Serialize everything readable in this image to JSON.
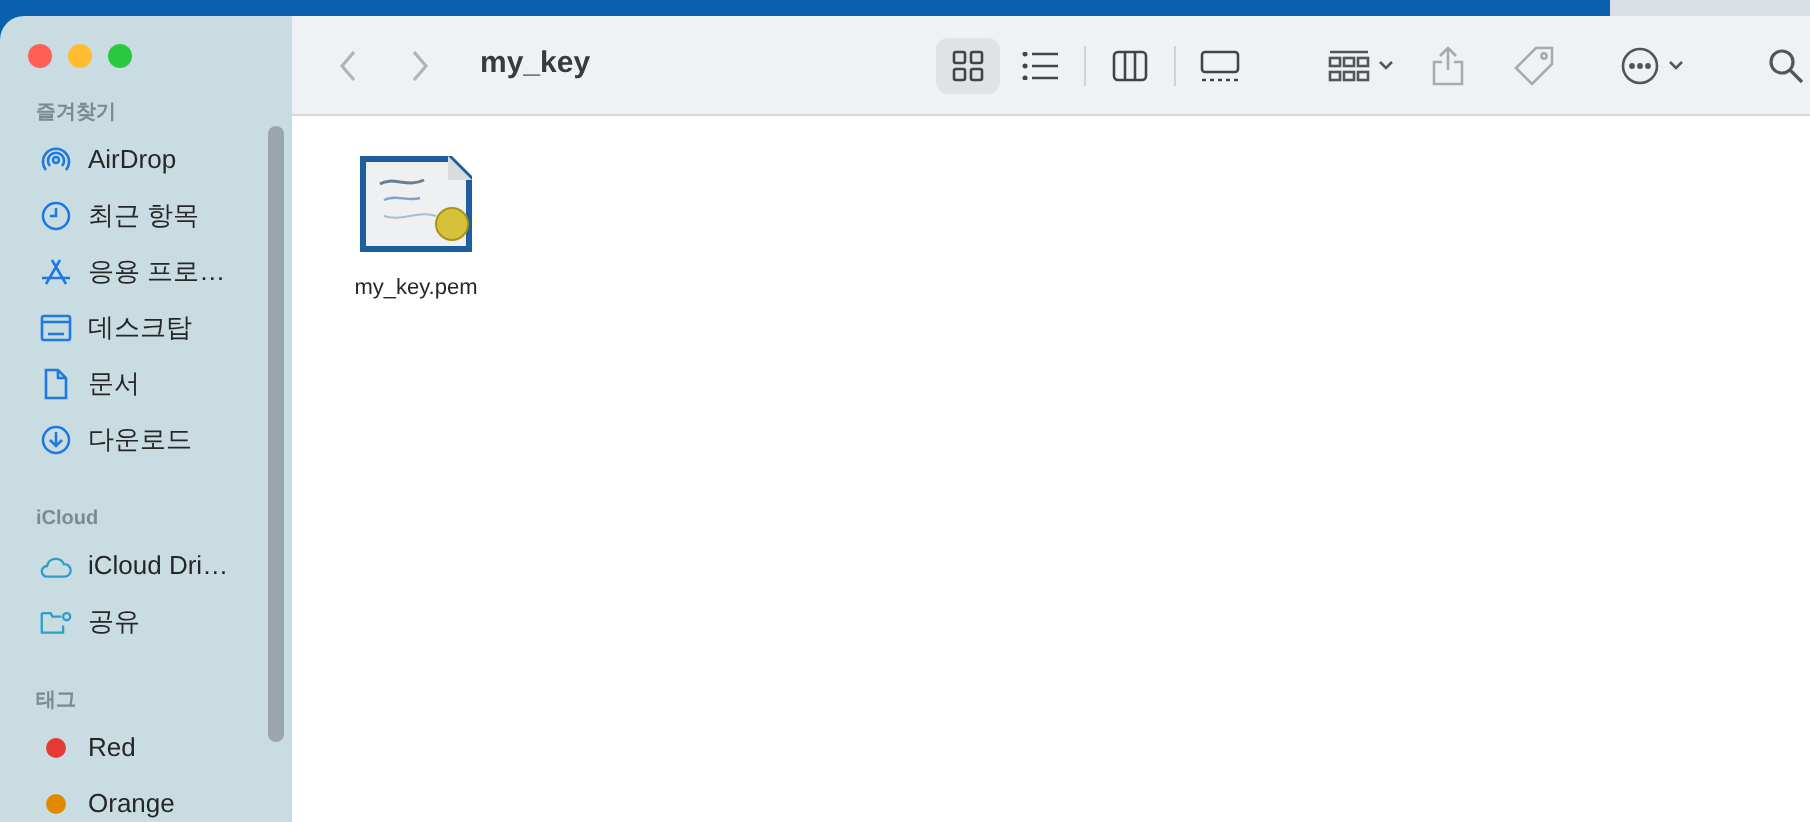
{
  "window": {
    "title": "my_key"
  },
  "toolbar": {
    "back_enabled": false,
    "forward_enabled": false,
    "view_buttons": [
      {
        "selected": true
      },
      {
        "selected": false
      },
      {
        "selected": false
      },
      {
        "selected": false
      }
    ]
  },
  "sidebar": {
    "sections": [
      {
        "heading": "즐겨찾기",
        "items": [
          {
            "kind": "place",
            "label": "AirDrop"
          },
          {
            "kind": "place",
            "label": "최근 항목"
          },
          {
            "kind": "place",
            "label": "응용 프로…"
          },
          {
            "kind": "place",
            "label": "데스크탑"
          },
          {
            "kind": "place",
            "label": "문서"
          },
          {
            "kind": "place",
            "label": "다운로드"
          }
        ]
      },
      {
        "heading": "iCloud",
        "items": [
          {
            "kind": "place",
            "label": "iCloud Dri…"
          },
          {
            "kind": "place",
            "label": "공유"
          }
        ]
      },
      {
        "heading": "태그",
        "items": [
          {
            "kind": "tag",
            "label": "Red",
            "color": "#e53935"
          },
          {
            "kind": "tag",
            "label": "Orange",
            "color": "#e08a00"
          }
        ]
      }
    ]
  },
  "files": [
    {
      "name": "my_key.pem"
    }
  ]
}
